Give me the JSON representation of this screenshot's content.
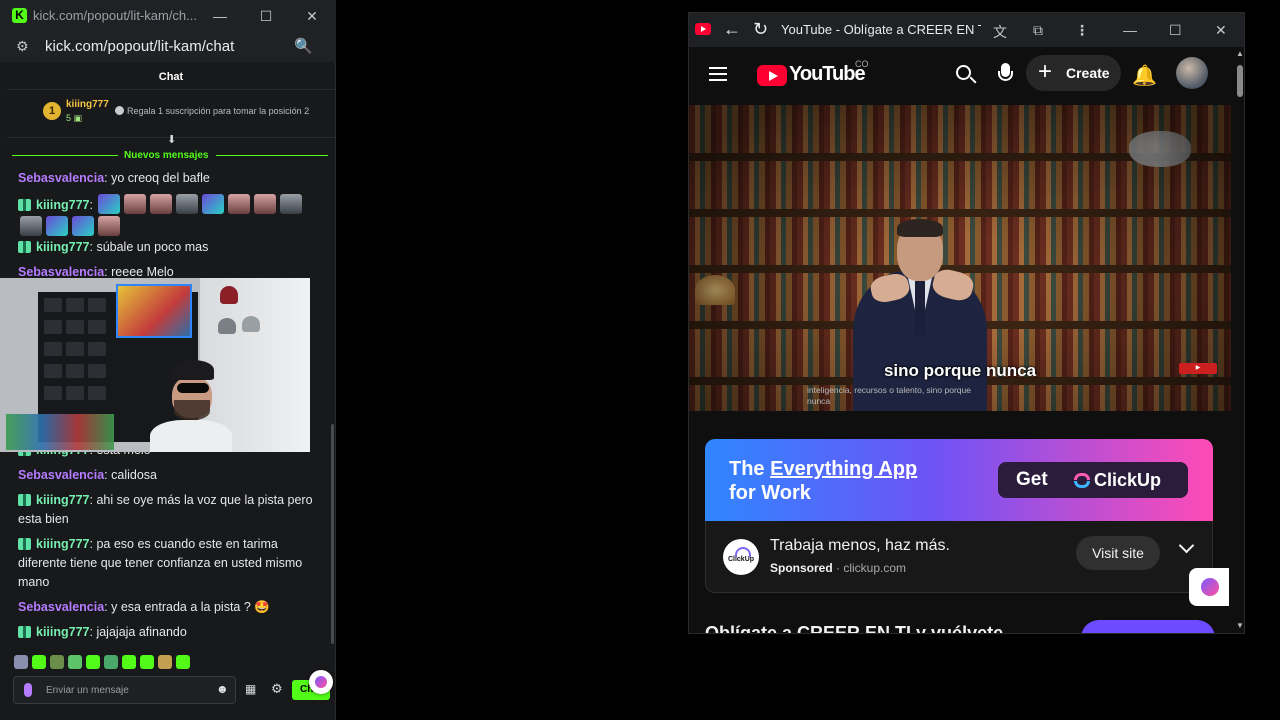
{
  "kick": {
    "window_title": "kick.com/popout/lit-kam/ch...",
    "url": "kick.com/popout/lit-kam/chat",
    "chat_header": "Chat",
    "pinned": {
      "rank": "1",
      "username": "kiiing777",
      "sub_count": "5",
      "message": "Regala 1 suscripción para tomar la posición 2"
    },
    "new_messages_label": "Nuevos mensajes",
    "messages": [
      {
        "user": "Sebasvalencia",
        "text": "yo creoq del bafle"
      },
      {
        "user": "kiiing777",
        "text": ""
      },
      {
        "user": "kiiing777",
        "text": "súbale un poco mas"
      },
      {
        "user": "Sebasvalencia",
        "text": "reeee Melo"
      },
      {
        "user": "kiiing777",
        "text": "esta melo"
      },
      {
        "user": "Sebasvalencia",
        "text": "calidosa"
      },
      {
        "user": "kiiing777",
        "text": "ahi se oye más la voz que la pista pero esta bien"
      },
      {
        "user": "kiiing777",
        "text": "pa eso es cuando este en tarima diferente tiene que tener confianza en usted mismo mano"
      },
      {
        "user": "Sebasvalencia",
        "text": "y esa entrada a la pista ? 🤩"
      },
      {
        "user": "kiiing777",
        "text": "jajajaja afinando"
      }
    ],
    "input_placeholder": "Enviar un mensaje",
    "send_label": "Chat",
    "colors": {
      "accent": "#53fc18",
      "purple_user": "#b57cff",
      "green_user": "#75f0b1"
    }
  },
  "youtube": {
    "window_title": "YouTube - Oblígate a CREER EN TI...",
    "logo_text": "YouTube",
    "country": "CO",
    "create_label": "Create",
    "caption_main": "sino porque nunca",
    "caption_small": "inteligencia, recursos o talento, sino porque nunca",
    "ad": {
      "headline_1": "The",
      "headline_2": "Everything App",
      "headline_3": "for Work",
      "cta_get": "Get",
      "cta_brand": "ClickUp",
      "logo_label": "ClickUp",
      "title": "Trabaja menos, haz más.",
      "sponsored": "Sponsored",
      "domain": "· clickup.com",
      "visit_label": "Visit site"
    },
    "video_title": "Oblígate a CREER EN TI y vuélvete",
    "colors": {
      "brand_red": "#ff0033",
      "ad_gradient_start": "#2f86ff",
      "ad_gradient_end": "#ff4bb5"
    }
  }
}
